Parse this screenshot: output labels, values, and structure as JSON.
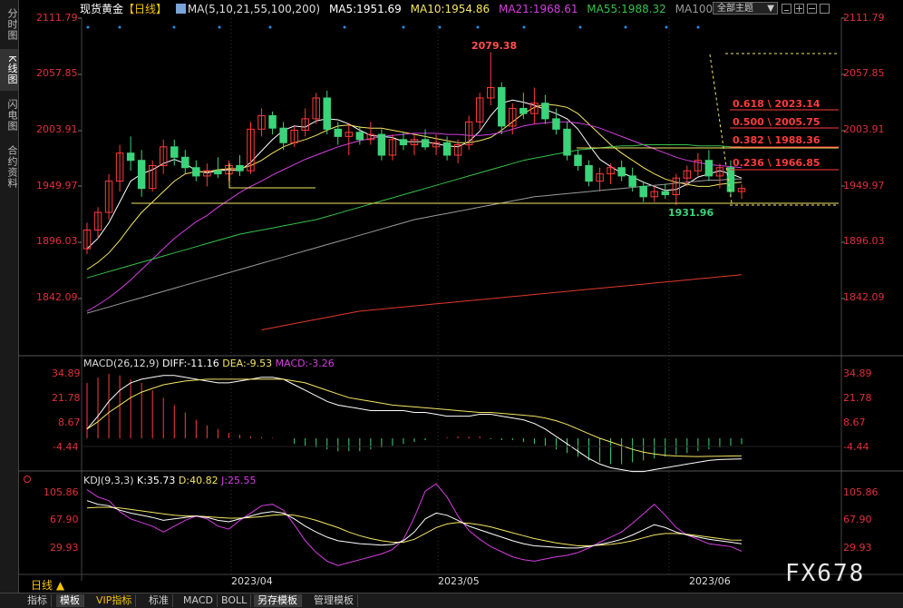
{
  "sidebar": {
    "tabs": [
      {
        "label": "分时图",
        "active": false
      },
      {
        "label": "K线图",
        "active": true
      },
      {
        "label": "闪电图",
        "active": false
      },
      {
        "label": "合约资料",
        "active": false
      }
    ]
  },
  "header": {
    "instrument": "现货黄金",
    "period": "【日线】",
    "ma_params": "MA(5,10,21,55,100,200)",
    "ma5": "MA5:1951.69",
    "ma10": "MA10:1954.86",
    "ma21": "MA21:1968.61",
    "ma55": "MA55:1988.32",
    "ma100": "MA100",
    "theme_button": "全部主题"
  },
  "price_axis": {
    "ticks": [
      "2111.79",
      "2057.85",
      "2003.91",
      "1949.97",
      "1896.03",
      "1842.09"
    ]
  },
  "annotations": {
    "high": "2079.38",
    "low": "1931.96",
    "fib": [
      "0.618 \\ 2023.14",
      "0.500 \\ 2005.75",
      "0.382 \\ 1988.36",
      "0.236 \\ 1966.85"
    ]
  },
  "macd": {
    "title": "MACD(26,12,9)",
    "diff": "DIFF:-11.16",
    "dea": "DEA:-9.53",
    "macd": "MACD:-3.26",
    "ticks": [
      "34.89",
      "21.78",
      "8.67",
      "-4.44"
    ]
  },
  "kdj": {
    "title": "KDJ(9,3,3)",
    "k": "K:35.73",
    "d": "D:40.82",
    "j": "J:25.55",
    "ticks": [
      "105.86",
      "67.90",
      "29.93"
    ]
  },
  "x_axis": {
    "labels": [
      "2023/04",
      "2023/05",
      "2023/06"
    ]
  },
  "period_selector": "日线 ▲",
  "bottom_tabs": [
    {
      "label": "指标",
      "selected": false
    },
    {
      "label": "模板",
      "selected": true
    },
    {
      "label": "VIP指标",
      "selected": false
    },
    {
      "label": "标准",
      "selected": false
    },
    {
      "label": "MACD",
      "selected": false
    },
    {
      "label": "BOLL",
      "selected": false
    },
    {
      "label": "另存模板",
      "selected": true
    },
    {
      "label": "管理模板",
      "selected": false
    }
  ],
  "watermark": "FX678",
  "colors": {
    "up": "#ff3b3b",
    "down": "#3cd47a",
    "ma5": "#ffffff",
    "ma10": "#f5e663",
    "ma21": "#d43fe0",
    "ma55": "#36c24a",
    "ma100": "#9a9a9a",
    "ma200": "#e03a2a",
    "axis_text": "#e0303a"
  },
  "chart_data": {
    "type": "candlestick",
    "title": "现货黄金【日线】",
    "ylim": [
      1810,
      2120
    ],
    "x": [
      "2023/04",
      "2023/05",
      "2023/06"
    ],
    "candles": [
      {
        "o": 1890,
        "h": 1915,
        "l": 1885,
        "c": 1908
      },
      {
        "o": 1908,
        "h": 1930,
        "l": 1900,
        "c": 1925
      },
      {
        "o": 1925,
        "h": 1962,
        "l": 1918,
        "c": 1955
      },
      {
        "o": 1955,
        "h": 1990,
        "l": 1945,
        "c": 1982
      },
      {
        "o": 1982,
        "h": 1998,
        "l": 1965,
        "c": 1975
      },
      {
        "o": 1975,
        "h": 1985,
        "l": 1940,
        "c": 1948
      },
      {
        "o": 1948,
        "h": 1975,
        "l": 1945,
        "c": 1970
      },
      {
        "o": 1970,
        "h": 1995,
        "l": 1962,
        "c": 1988
      },
      {
        "o": 1988,
        "h": 1995,
        "l": 1970,
        "c": 1978
      },
      {
        "o": 1978,
        "h": 1985,
        "l": 1962,
        "c": 1968
      },
      {
        "o": 1968,
        "h": 1975,
        "l": 1955,
        "c": 1960
      },
      {
        "o": 1960,
        "h": 1972,
        "l": 1950,
        "c": 1965
      },
      {
        "o": 1965,
        "h": 1978,
        "l": 1958,
        "c": 1962
      },
      {
        "o": 1962,
        "h": 1975,
        "l": 1955,
        "c": 1970
      },
      {
        "o": 1970,
        "h": 1980,
        "l": 1960,
        "c": 1965
      },
      {
        "o": 1965,
        "h": 2012,
        "l": 1962,
        "c": 2005
      },
      {
        "o": 2005,
        "h": 2025,
        "l": 1998,
        "c": 2018
      },
      {
        "o": 2018,
        "h": 2022,
        "l": 2000,
        "c": 2006
      },
      {
        "o": 2006,
        "h": 2012,
        "l": 1985,
        "c": 1992
      },
      {
        "o": 1992,
        "h": 2008,
        "l": 1988,
        "c": 2004
      },
      {
        "o": 2004,
        "h": 2025,
        "l": 1998,
        "c": 2015
      },
      {
        "o": 2015,
        "h": 2040,
        "l": 2010,
        "c": 2035
      },
      {
        "o": 2035,
        "h": 2042,
        "l": 2000,
        "c": 2005
      },
      {
        "o": 2005,
        "h": 2012,
        "l": 1990,
        "c": 1998
      },
      {
        "o": 1998,
        "h": 2010,
        "l": 1980,
        "c": 2002
      },
      {
        "o": 2002,
        "h": 2008,
        "l": 1990,
        "c": 1995
      },
      {
        "o": 1995,
        "h": 2012,
        "l": 1990,
        "c": 2000
      },
      {
        "o": 2000,
        "h": 2005,
        "l": 1975,
        "c": 1980
      },
      {
        "o": 1980,
        "h": 2000,
        "l": 1975,
        "c": 1995
      },
      {
        "o": 1995,
        "h": 2002,
        "l": 1985,
        "c": 1990
      },
      {
        "o": 1990,
        "h": 2000,
        "l": 1980,
        "c": 1995
      },
      {
        "o": 1995,
        "h": 2005,
        "l": 1985,
        "c": 1988
      },
      {
        "o": 1988,
        "h": 2000,
        "l": 1980,
        "c": 1992
      },
      {
        "o": 1992,
        "h": 1998,
        "l": 1975,
        "c": 1980
      },
      {
        "o": 1980,
        "h": 1995,
        "l": 1972,
        "c": 1990
      },
      {
        "o": 1990,
        "h": 2018,
        "l": 1985,
        "c": 2012
      },
      {
        "o": 2012,
        "h": 2040,
        "l": 2005,
        "c": 2035
      },
      {
        "o": 2035,
        "h": 2079,
        "l": 2028,
        "c": 2045
      },
      {
        "o": 2045,
        "h": 2050,
        "l": 2000,
        "c": 2008
      },
      {
        "o": 2008,
        "h": 2030,
        "l": 2000,
        "c": 2025
      },
      {
        "o": 2025,
        "h": 2040,
        "l": 2015,
        "c": 2020
      },
      {
        "o": 2020,
        "h": 2045,
        "l": 2010,
        "c": 2030
      },
      {
        "o": 2030,
        "h": 2038,
        "l": 2010,
        "c": 2015
      },
      {
        "o": 2015,
        "h": 2025,
        "l": 2000,
        "c": 2005
      },
      {
        "o": 2005,
        "h": 2012,
        "l": 1975,
        "c": 1980
      },
      {
        "o": 1980,
        "h": 1985,
        "l": 1965,
        "c": 1970
      },
      {
        "o": 1970,
        "h": 1975,
        "l": 1950,
        "c": 1955
      },
      {
        "o": 1955,
        "h": 1968,
        "l": 1945,
        "c": 1962
      },
      {
        "o": 1962,
        "h": 1972,
        "l": 1952,
        "c": 1968
      },
      {
        "o": 1968,
        "h": 1975,
        "l": 1955,
        "c": 1960
      },
      {
        "o": 1960,
        "h": 1968,
        "l": 1945,
        "c": 1950
      },
      {
        "o": 1950,
        "h": 1955,
        "l": 1935,
        "c": 1940
      },
      {
        "o": 1940,
        "h": 1950,
        "l": 1935,
        "c": 1945
      },
      {
        "o": 1945,
        "h": 1952,
        "l": 1938,
        "c": 1942
      },
      {
        "o": 1942,
        "h": 1962,
        "l": 1932,
        "c": 1958
      },
      {
        "o": 1958,
        "h": 1970,
        "l": 1950,
        "c": 1965
      },
      {
        "o": 1965,
        "h": 1982,
        "l": 1960,
        "c": 1975
      },
      {
        "o": 1975,
        "h": 1985,
        "l": 1955,
        "c": 1960
      },
      {
        "o": 1960,
        "h": 1972,
        "l": 1948,
        "c": 1968
      },
      {
        "o": 1968,
        "h": 1975,
        "l": 1940,
        "c": 1945
      },
      {
        "o": 1945,
        "h": 1952,
        "l": 1938,
        "c": 1948
      }
    ],
    "ma_series": [
      {
        "name": "MA5",
        "values": [
          1890,
          1900,
          1915,
          1935,
          1955,
          1962,
          1966,
          1972,
          1976,
          1972,
          1965,
          1963,
          1965,
          1966,
          1965,
          1973,
          1984,
          1995,
          2004,
          2008,
          2007,
          2013,
          2015,
          2014,
          2010,
          2004,
          1999,
          1998,
          1997,
          1993,
          1993,
          1993,
          1991,
          1989,
          1988,
          1993,
          2003,
          2018,
          2030,
          2033,
          2031,
          2028,
          2024,
          2020,
          2015,
          2005,
          1990,
          1976,
          1969,
          1963,
          1959,
          1954,
          1950,
          1946,
          1947,
          1952,
          1959,
          1962,
          1965,
          1962,
          1958
        ]
      },
      {
        "name": "MA10",
        "values": [
          1870,
          1877,
          1886,
          1898,
          1912,
          1925,
          1935,
          1945,
          1955,
          1962,
          1964,
          1964,
          1966,
          1967,
          1967,
          1970,
          1975,
          1982,
          1988,
          1992,
          1995,
          1999,
          2004,
          2008,
          2009,
          2007,
          2006,
          2006,
          2004,
          2002,
          2000,
          1998,
          1996,
          1994,
          1992,
          1992,
          1994,
          1997,
          2004,
          2012,
          2020,
          2026,
          2029,
          2028,
          2026,
          2020,
          2010,
          2000,
          1990,
          1982,
          1975,
          1968,
          1962,
          1957,
          1954,
          1952,
          1950,
          1950,
          1952,
          1953,
          1954
        ]
      },
      {
        "name": "MA21",
        "values": [
          1830,
          1836,
          1843,
          1851,
          1860,
          1870,
          1880,
          1890,
          1900,
          1908,
          1916,
          1922,
          1930,
          1937,
          1944,
          1950,
          1955,
          1961,
          1966,
          1971,
          1976,
          1980,
          1984,
          1988,
          1991,
          1994,
          1996,
          1998,
          1999,
          2000,
          2001,
          2001,
          2001,
          2000,
          2000,
          1999,
          1999,
          2000,
          2002,
          2005,
          2008,
          2010,
          2011,
          2012,
          2012,
          2011,
          2009,
          2006,
          2002,
          1998,
          1994,
          1990,
          1986,
          1982,
          1978,
          1975,
          1973,
          1971,
          1970,
          1969,
          1968
        ]
      },
      {
        "name": "MA55",
        "values": [
          1862,
          1865,
          1868,
          1871,
          1874,
          1877,
          1880,
          1883,
          1886,
          1889,
          1892,
          1895,
          1898,
          1901,
          1904,
          1906,
          1908,
          1910,
          1912,
          1914,
          1916,
          1918,
          1921,
          1924,
          1927,
          1930,
          1933,
          1936,
          1939,
          1942,
          1945,
          1948,
          1951,
          1954,
          1957,
          1960,
          1963,
          1966,
          1969,
          1972,
          1975,
          1977,
          1979,
          1981,
          1983,
          1985,
          1986,
          1987,
          1988,
          1989,
          1989,
          1990,
          1990,
          1990,
          1990,
          1990,
          1989,
          1989,
          1989,
          1988,
          1988
        ]
      },
      {
        "name": "MA100",
        "values": [
          1828,
          1831,
          1834,
          1837,
          1840,
          1843,
          1846,
          1849,
          1852,
          1855,
          1858,
          1861,
          1864,
          1867,
          1870,
          1873,
          1876,
          1879,
          1882,
          1885,
          1888,
          1891,
          1894,
          1897,
          1900,
          1903,
          1906,
          1909,
          1912,
          1915,
          1918,
          1920,
          1922,
          1924,
          1926,
          1928,
          1930,
          1932,
          1934,
          1936,
          1938,
          1940,
          1941,
          1942,
          1943,
          1944,
          1945,
          1946,
          1947,
          1948,
          1949,
          1950,
          1951,
          1952,
          1953,
          1954,
          1955,
          1956,
          1956,
          1957,
          1957
        ]
      },
      {
        "name": "MA200",
        "values": [
          null,
          null,
          null,
          null,
          null,
          null,
          null,
          null,
          null,
          null,
          null,
          null,
          null,
          null,
          null,
          null,
          1812,
          1814,
          1816,
          1818,
          1820,
          1822,
          1824,
          1826,
          1828,
          1830,
          1831,
          1832,
          1833,
          1834,
          1835,
          1836,
          1837,
          1838,
          1839,
          1840,
          1841,
          1842,
          1843,
          1844,
          1845,
          1846,
          1847,
          1848,
          1849,
          1850,
          1851,
          1852,
          1853,
          1854,
          1855,
          1856,
          1857,
          1858,
          1859,
          1860,
          1861,
          1862,
          1863,
          1864,
          1865
        ]
      }
    ],
    "macd_hist": [
      30,
      33,
      35,
      34,
      32,
      30,
      26,
      22,
      18,
      14,
      10,
      7,
      5,
      3,
      2,
      1,
      0.5,
      0.3,
      0,
      -3,
      -4,
      -5,
      -6,
      -7,
      -7,
      -7,
      -6,
      -5,
      -4,
      -3,
      -2,
      -1,
      0,
      0.5,
      1,
      1,
      1,
      -0.5,
      -1,
      -1,
      -2,
      -3,
      -4,
      -6,
      -8,
      -10,
      -12,
      -13,
      -14,
      -14,
      -13,
      -12,
      -11,
      -10,
      -9,
      -8,
      -7,
      -6,
      -5,
      -4,
      -3.26
    ],
    "macd_diff": [
      5,
      12,
      20,
      26,
      30,
      32,
      33,
      34,
      34,
      33,
      32,
      31,
      30,
      30,
      31,
      32,
      33,
      33,
      32,
      29,
      26,
      23,
      20,
      18,
      17,
      16,
      15,
      15,
      15,
      15,
      14,
      14,
      13,
      12,
      12,
      12,
      13,
      13,
      12,
      11,
      10,
      8,
      5,
      1,
      -3,
      -7,
      -11,
      -14,
      -16,
      -17,
      -18,
      -18,
      -17,
      -16,
      -15,
      -14,
      -13,
      -12,
      -11.5,
      -11.3,
      -11.16
    ],
    "macd_dea": [
      5,
      9,
      14,
      18,
      22,
      25,
      27,
      29,
      30,
      31,
      31.5,
      32,
      32,
      32,
      32,
      32,
      32,
      32,
      32,
      31,
      30,
      28,
      26,
      24,
      22,
      21,
      20,
      19,
      18,
      17.5,
      17,
      16.5,
      16,
      15.5,
      15,
      14.5,
      14,
      14,
      13.5,
      13,
      12.5,
      12,
      11,
      9.5,
      7.5,
      5,
      2.5,
      0,
      -2,
      -4,
      -6,
      -7.5,
      -8.5,
      -9.2,
      -9.6,
      -9.8,
      -9.9,
      -9.8,
      -9.7,
      -9.6,
      -9.53
    ],
    "kdj_k": [
      95,
      90,
      88,
      82,
      78,
      75,
      72,
      68,
      70,
      72,
      74,
      72,
      68,
      66,
      70,
      74,
      78,
      80,
      78,
      70,
      60,
      52,
      45,
      40,
      38,
      36,
      35,
      34,
      35,
      40,
      52,
      70,
      78,
      75,
      68,
      60,
      55,
      50,
      45,
      40,
      36,
      33,
      32,
      31,
      30,
      30,
      32,
      35,
      38,
      42,
      48,
      55,
      62,
      58,
      52,
      48,
      45,
      42,
      40,
      38,
      35.73
    ],
    "kdj_d": [
      85,
      86,
      86,
      85,
      83,
      81,
      79,
      77,
      75,
      74,
      74,
      73,
      72,
      71,
      71,
      72,
      73,
      75,
      76,
      75,
      72,
      68,
      63,
      58,
      52,
      47,
      43,
      40,
      38,
      38,
      42,
      50,
      58,
      63,
      65,
      64,
      62,
      59,
      55,
      51,
      47,
      43,
      40,
      37,
      35,
      33,
      33,
      34,
      35,
      37,
      40,
      44,
      48,
      50,
      50,
      49,
      47,
      45,
      43,
      41,
      40.82
    ],
    "kdj_j": [
      110,
      100,
      95,
      80,
      70,
      65,
      60,
      52,
      60,
      68,
      74,
      70,
      60,
      56,
      68,
      78,
      88,
      90,
      82,
      62,
      40,
      24,
      12,
      6,
      10,
      14,
      18,
      22,
      28,
      42,
      72,
      108,
      118,
      100,
      74,
      54,
      42,
      32,
      25,
      18,
      14,
      12,
      15,
      18,
      20,
      24,
      30,
      38,
      45,
      52,
      64,
      77,
      90,
      75,
      58,
      48,
      42,
      36,
      34,
      32,
      25.55
    ]
  }
}
